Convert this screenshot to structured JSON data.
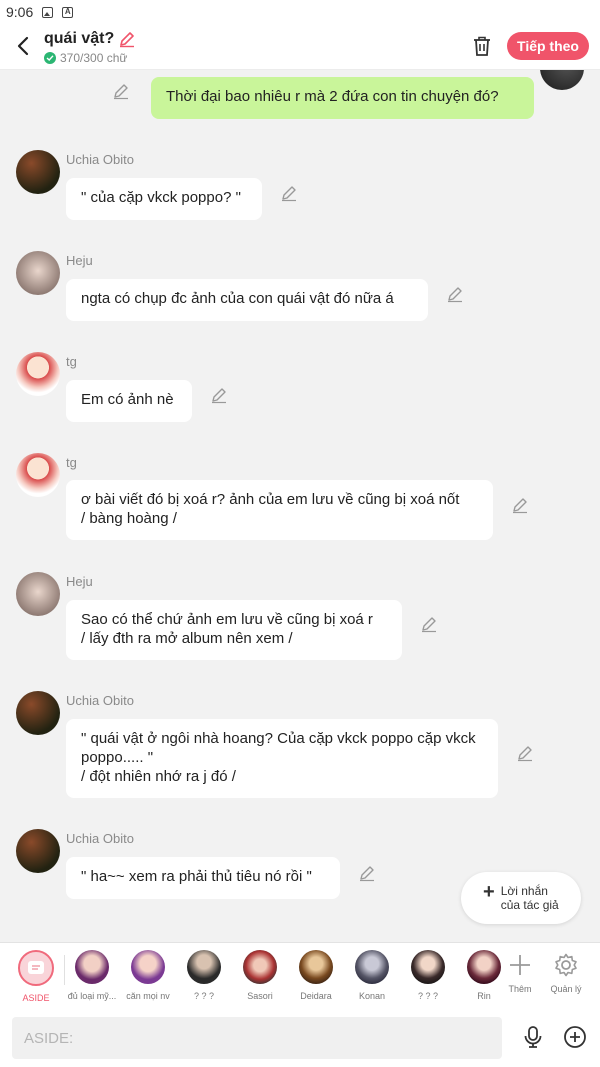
{
  "status_bar": {
    "time": "9:06"
  },
  "header": {
    "title": "quái vật?",
    "word_count": "370/300 chữ",
    "next_label": "Tiếp theo"
  },
  "messages": [
    {
      "sender": "",
      "text": "Thời đại bao nhiêu r mà 2 đứa con tin chuyện  đó?",
      "side": "right"
    },
    {
      "sender": "Uchia Obito",
      "text": "\" của cặp vkck poppo? \"",
      "side": "left"
    },
    {
      "sender": "Heju",
      "text": "ngta có chụp đc ảnh của con quái vật đó nữa á",
      "side": "left"
    },
    {
      "sender": "tg",
      "text": "Em có ảnh nè",
      "side": "left"
    },
    {
      "sender": "tg",
      "text": "ơ bài viết đó bị xoá r? ảnh của em lưu về cũng bị xoá nốt\n/ bàng hoàng /",
      "side": "left"
    },
    {
      "sender": "Heju",
      "text": "Sao có thể chứ ảnh em lưu về cũng bị xoá r\n/ lấy đth ra mở album nên xem /",
      "side": "left"
    },
    {
      "sender": "Uchia Obito",
      "text": "\" quái vật ở ngôi nhà hoang? Của cặp vkck poppo cặp vkck poppo..... \"\n/ đột nhiên nhớ ra j đó /",
      "side": "left"
    },
    {
      "sender": "Uchia Obito",
      "text": "\" ha~~ xem ra phải thủ tiêu nó rồi \"",
      "side": "left"
    }
  ],
  "author_note": {
    "line1": "Lời nhắn",
    "line2": "của tác giả"
  },
  "characters": [
    {
      "label": "ASIDE",
      "active": true
    },
    {
      "label": "đủ loại mỹ..."
    },
    {
      "label": "căn mọi nv"
    },
    {
      "label": "? ? ?"
    },
    {
      "label": "Sasori"
    },
    {
      "label": "Deidara"
    },
    {
      "label": "Konan"
    },
    {
      "label": "? ? ?"
    },
    {
      "label": "Rin"
    }
  ],
  "tools": {
    "more_label": "Thêm",
    "manage_label": "Quản lý"
  },
  "input": {
    "placeholder": "ASIDE:"
  },
  "colors": {
    "accent": "#f0546a",
    "my_bubble": "#c9f59a",
    "background": "#f2f2f2"
  }
}
